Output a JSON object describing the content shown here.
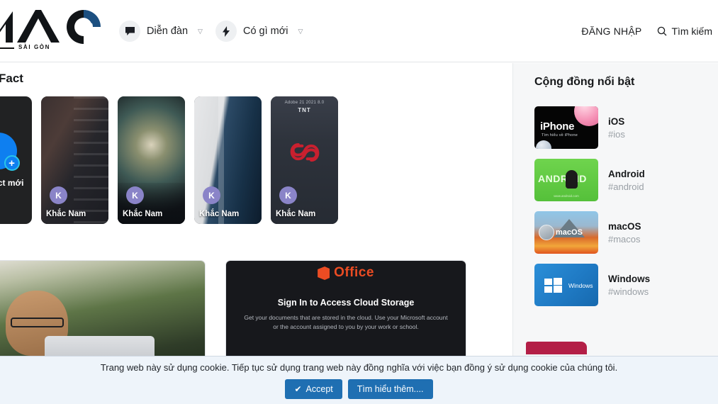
{
  "header": {
    "logo": {
      "text": "MAC",
      "subtitle": "SÀI GÒN"
    },
    "nav": [
      {
        "label": "Diễn đàn",
        "icon": "forum-bubble-icon",
        "chevron": "▽"
      },
      {
        "label": "Có gì mới",
        "icon": "lightning-bolt-icon",
        "chevron": "▽"
      }
    ],
    "login_label": "ĐĂNG NHẬP",
    "search_label": "Tìm kiếm",
    "search_icon": "search-icon"
  },
  "main": {
    "section_title": "Fact",
    "create_fact": {
      "label": "Tạo fact mới",
      "plus": "+"
    },
    "facts": [
      {
        "name": "Khắc Nam",
        "avatar_initial": "K"
      },
      {
        "name": "Khắc Nam",
        "avatar_initial": "K"
      },
      {
        "name": "Khắc Nam",
        "avatar_initial": "K"
      },
      {
        "name": "Khắc Nam",
        "avatar_initial": "K",
        "overlay_top": "Adobe 21 2021 8.0",
        "overlay_title": "TNT"
      }
    ],
    "cards": [
      {
        "kind": "photo",
        "alt": "man-with-glasses-at-laptop"
      },
      {
        "kind": "office",
        "brand": "Office",
        "title": "Sign In to Access Cloud Storage",
        "subtitle": "Get your documents that are stored in the cloud. Use your Microsoft account or the account assigned to you by your work or school."
      }
    ]
  },
  "sidebar": {
    "title": "Cộng đồng nổi bật",
    "items": [
      {
        "name": "iOS",
        "tag": "#ios",
        "tile_text": "iPhone",
        "tile_sub": "Tìm hiểu về iPhone"
      },
      {
        "name": "Android",
        "tag": "#android",
        "tile_text": "ANDROID",
        "tile_sub": "www.android.com"
      },
      {
        "name": "macOS",
        "tag": "#macos",
        "tile_text": "macOS"
      },
      {
        "name": "Windows",
        "tag": "#windows",
        "tile_text": "Windows"
      }
    ]
  },
  "cookie": {
    "message": "Trang web này sử dụng cookie. Tiếp tục sử dụng trang web này đồng nghĩa với việc bạn đồng ý sử dụng cookie của chúng tôi.",
    "accept_label": "Accept",
    "accept_check": "✔",
    "learn_more_label": "Tìm hiểu thêm...."
  },
  "colors": {
    "accent_blue": "#1f6fb2",
    "create_blue": "#0e7ff0",
    "avatar_purple": "#8a84c8",
    "cookie_bg": "#eef4fa",
    "sidebar_bg": "#f6f7f8",
    "promo_red": "#b31f47"
  }
}
